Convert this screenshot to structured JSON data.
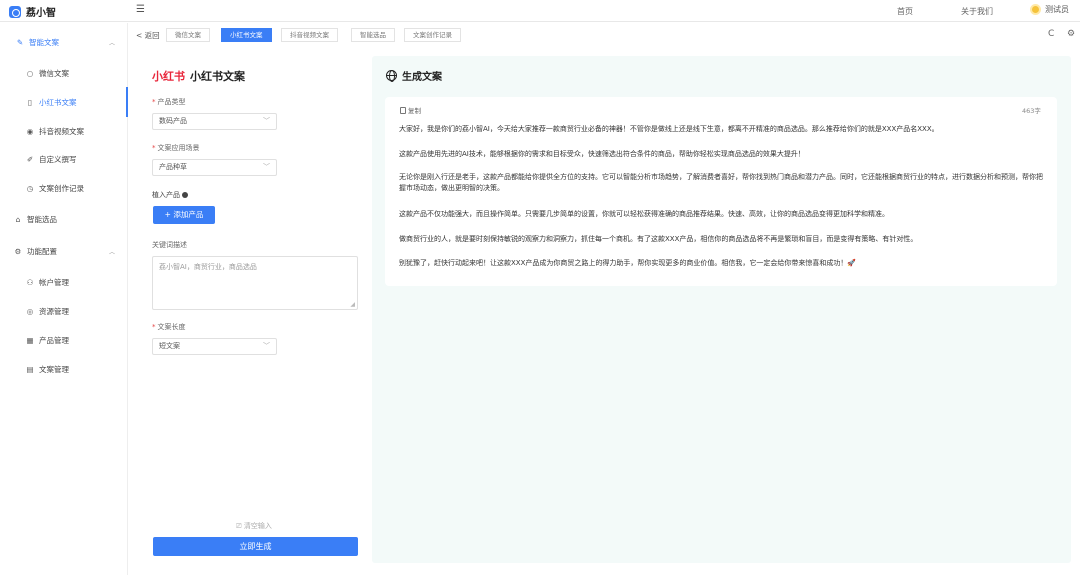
{
  "app": {
    "name": "荔小智"
  },
  "header": {
    "nav": [
      "首页",
      "关于我们"
    ],
    "user": "测试员"
  },
  "tabbar": {
    "back": "< 返回",
    "tabs": [
      {
        "label": "微信文案",
        "active": false
      },
      {
        "label": "小红书文案",
        "active": true
      },
      {
        "label": "抖音视频文案",
        "active": false
      },
      {
        "label": "智能选品",
        "active": false
      },
      {
        "label": "文案创作记录",
        "active": false
      }
    ],
    "tools": [
      "C",
      "⚙"
    ]
  },
  "sidebar": {
    "items": [
      {
        "label": "智能文案",
        "icon": "wand-icon"
      },
      {
        "label": "微信文案",
        "icon": "chat-icon"
      },
      {
        "label": "小红书文案",
        "icon": "note-icon"
      },
      {
        "label": "抖音视频文案",
        "icon": "play-icon"
      },
      {
        "label": "自定义撰写",
        "icon": "edit-icon"
      },
      {
        "label": "文案创作记录",
        "icon": "clock-icon"
      },
      {
        "label": "智能选品",
        "icon": "bag-icon"
      },
      {
        "label": "功能配置",
        "icon": "gear-icon"
      },
      {
        "label": "帐户管理",
        "icon": "users-icon"
      },
      {
        "label": "资源管理",
        "icon": "resource-icon"
      },
      {
        "label": "产品管理",
        "icon": "grid-icon"
      },
      {
        "label": "文案管理",
        "icon": "doc-icon"
      }
    ]
  },
  "form": {
    "brand": "小红书",
    "title": "小红书文案",
    "product_type_label": "产品类型",
    "product_type_value": "数码产品",
    "scene_label": "文案应用场景",
    "scene_value": "产品种草",
    "product_label": "植入产品",
    "add_product": "+ 添加产品",
    "keyword_label": "关键词描述",
    "keyword_placeholder": "荔小智AI，商贸行业，商品选品",
    "length_label": "文案长度",
    "length_value": "短文案",
    "clear": "清空输入",
    "generate": "立即生成"
  },
  "result": {
    "title": "生成文案",
    "copy_label": "复制",
    "count": "463字",
    "paragraphs": [
      "大家好，我是你们的荔小智AI，今天给大家推荐一款商贸行业必备的神器！不管你是做线上还是线下生意，都离不开精准的商品选品。那么推荐给你们的就是XXX产品名XXX。",
      "这款产品使用先进的AI技术，能够根据你的需求和目标受众，快速筛选出符合条件的商品，帮助你轻松实现商品选品的效果大提升！",
      "无论你是刚入行还是老手，这款产品都能给你提供全方位的支持。它可以智能分析市场趋势，了解消费者喜好，帮你找到热门商品和潜力产品。同时，它还能根据商贸行业的特点，进行数据分析和预测，帮你把握市场动态，做出更明智的决策。",
      "这款产品不仅功能强大，而且操作简单。只需要几步简单的设置，你就可以轻松获得准确的商品推荐结果。快速、高效，让你的商品选品变得更加科学和精准。",
      "做商贸行业的人，就是要时刻保持敏锐的观察力和洞察力，抓住每一个商机。有了这款XXX产品，相信你的商品选品将不再是繁琐和盲目，而是变得有策略、有针对性。",
      "别犹豫了，赶快行动起来吧！让这款XXX产品成为你商贸之路上的得力助手，帮你实现更多的商业价值。相信我，它一定会给你带来惊喜和成功！🚀"
    ]
  },
  "colors": {
    "accent": "#3a7ef6",
    "brand_red": "#e8263a",
    "panel_bg": "#f3faf9"
  }
}
